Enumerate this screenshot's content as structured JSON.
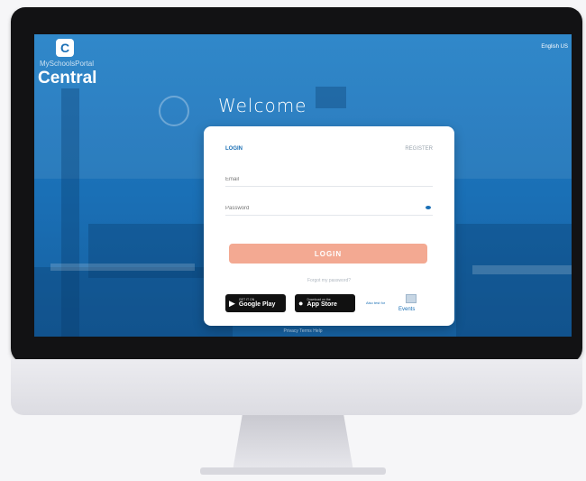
{
  "app": {
    "brand_sub": "MySchoolsPortal",
    "brand_name": "Central",
    "logo_letter": "C",
    "language": "English US"
  },
  "welcome": "Welcome",
  "login_card": {
    "tab_login": "LOGIN",
    "tab_register": "REGISTER",
    "email_placeholder": "Email",
    "password_placeholder": "Password",
    "submit_label": "LOGIN",
    "forgot_label": "Forgot my password?"
  },
  "stores": {
    "google_small": "GET IT ON",
    "google_label": "Google Play",
    "apple_small": "Download on the",
    "apple_label": "App Store",
    "also_label": "Also test for",
    "windows_label": "Events"
  },
  "footer": {
    "links": "Privacy   Terms   Help"
  },
  "colors": {
    "screen_blue": "#1a6fb5",
    "login_button": "#f3a992",
    "bezel": "#121214"
  },
  "icons": [
    "logo-icon",
    "eye-icon",
    "google-play-icon",
    "apple-icon",
    "windows-icon"
  ]
}
